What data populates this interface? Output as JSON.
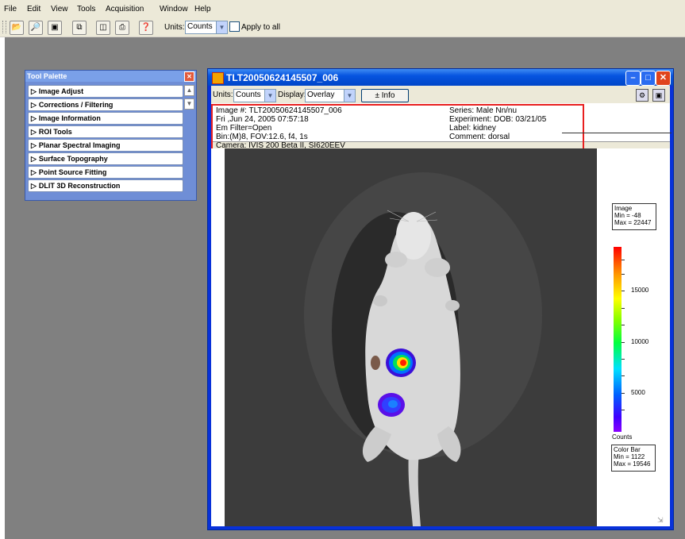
{
  "menu": [
    "File",
    "Edit",
    "View",
    "Tools",
    "Acquisition",
    "Window",
    "Help"
  ],
  "toolbar": {
    "units_label": "Units:",
    "units_value": "Counts",
    "apply_all_label": "Apply to all",
    "icons": [
      "open-folder-icon",
      "browse-icon",
      "save-icon",
      "copy-icon",
      "print-preview-icon",
      "print-icon",
      "help-pointer-icon"
    ]
  },
  "palette": {
    "title": "Tool Palette",
    "items": [
      {
        "label": "Image Adjust"
      },
      {
        "label": "Corrections / Filtering"
      },
      {
        "label": "Image Information"
      },
      {
        "label": "ROI Tools"
      },
      {
        "label": "Planar Spectral Imaging"
      },
      {
        "label": "Surface Topography"
      },
      {
        "label": "Point Source Fitting"
      },
      {
        "label": "DLIT 3D Reconstruction"
      }
    ]
  },
  "image_window": {
    "title": "TLT20050624145507_006",
    "units_label": "Units:",
    "units_value": "Counts",
    "display_label": "Display:",
    "display_value": "Overlay",
    "info_button": "± Info",
    "info": {
      "left": [
        "Image #: TLT20050624145507_006",
        "Fri ,Jun 24, 2005 07:57:18",
        "Em Filter=Open",
        "Bin:(M)8, FOV:12.6, f4, 1s",
        "Camera: IVIS 200 Beta II, SI620EEV"
      ],
      "right": [
        "Series: Male Nn/nu",
        "Experiment: DOB: 03/21/05",
        "Label: kidney",
        "Comment: dorsal"
      ]
    },
    "image_stats": {
      "title": "Image",
      "min": "Min = -48",
      "max": "Max = 22447"
    },
    "colorbar": {
      "ticks": [
        "15000",
        "10000",
        "5000"
      ],
      "units": "Counts",
      "title": "Color Bar",
      "min": "Min = 1122",
      "max": "Max = 19546"
    }
  }
}
